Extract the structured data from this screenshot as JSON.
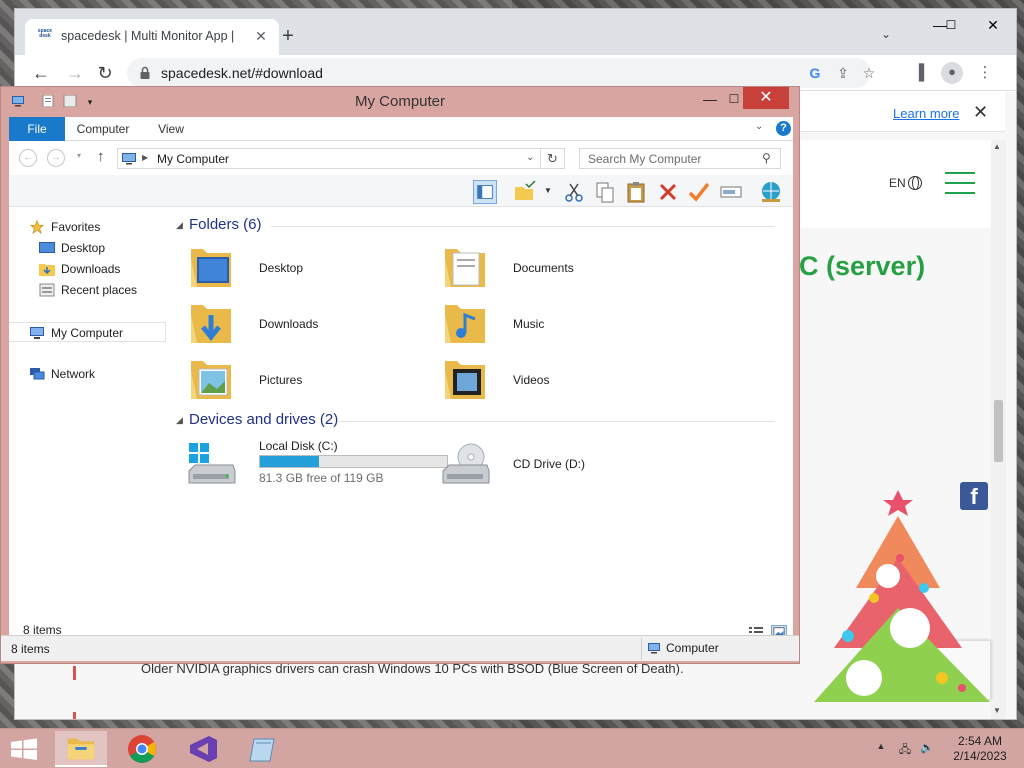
{
  "browser": {
    "tab_title": "spacedesk | Multi Monitor App |",
    "tab_favicon_text": "space desk",
    "url": "spacedesk.net/#download",
    "learn_more": "Learn more",
    "lang": "EN",
    "heading_fragment": "C (server)",
    "warning_fragment": "Older NVIDIA graphics drivers can crash Windows 10 PCs with BSOD (Blue Screen of Death).",
    "fb_letter": "f"
  },
  "explorer": {
    "title": "My Computer",
    "ribbon_tabs": [
      "File",
      "Computer",
      "View"
    ],
    "address": "My Computer",
    "search_placeholder": "Search My Computer",
    "nav": {
      "favorites": "Favorites",
      "desktop": "Desktop",
      "downloads": "Downloads",
      "recent": "Recent places",
      "computer": "My Computer",
      "network": "Network"
    },
    "folders_header": "Folders (6)",
    "folders": [
      "Desktop",
      "Documents",
      "Downloads",
      "Music",
      "Pictures",
      "Videos"
    ],
    "devices_header": "Devices and drives (2)",
    "drives": [
      {
        "name": "Local Disk (C:)",
        "free": "81.3 GB free of 119 GB",
        "used_fraction": 0.317
      },
      {
        "name": "CD Drive (D:)"
      }
    ],
    "status_items": "8 items",
    "status2_items": "8 items",
    "status2_location": "Computer"
  },
  "taskbar": {
    "time": "2:54 AM",
    "date": "2/14/2023"
  },
  "colors": {
    "accent_blue": "#1979ca",
    "window_frame": "#d8a5a1",
    "close_red": "#c7413a",
    "heading_green": "#27a045",
    "drive_fill": "#26a0da"
  }
}
